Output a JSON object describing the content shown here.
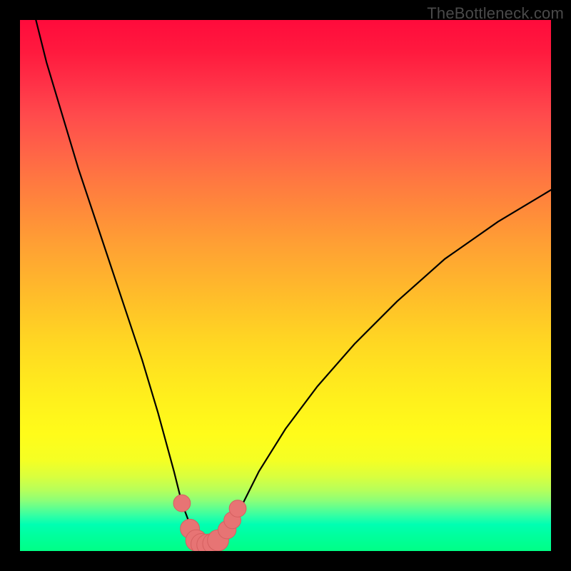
{
  "watermark": "TheBottleneck.com",
  "colors": {
    "frame": "#000000",
    "curve": "#000000",
    "marker_fill": "#e77474",
    "marker_stroke": "#d56060"
  },
  "chart_data": {
    "type": "line",
    "title": "",
    "xlabel": "",
    "ylabel": "",
    "xlim": [
      0,
      100
    ],
    "ylim": [
      0,
      100
    ],
    "grid": false,
    "legend": false,
    "series": [
      {
        "name": "bottleneck-curve",
        "x": [
          3,
          5,
          8,
          11,
          14,
          17,
          20,
          23,
          26,
          29,
          30.5,
          32,
          33.2,
          34.2,
          35,
          36,
          37,
          38.5,
          40,
          42,
          45,
          50,
          56,
          63,
          71,
          80,
          90,
          100
        ],
        "values": [
          100,
          92,
          82,
          72,
          63,
          54,
          45,
          36,
          26,
          15,
          9,
          5,
          2.5,
          1.5,
          1.2,
          1.2,
          1.5,
          2.5,
          5,
          9,
          15,
          23,
          31,
          39,
          47,
          55,
          62,
          68
        ]
      }
    ],
    "markers": [
      {
        "x": 30.5,
        "y": 9.0,
        "r": 1.6
      },
      {
        "x": 32.0,
        "y": 4.2,
        "r": 1.8
      },
      {
        "x": 33.2,
        "y": 2.0,
        "r": 2.0
      },
      {
        "x": 34.2,
        "y": 1.3,
        "r": 2.0
      },
      {
        "x": 35.3,
        "y": 1.2,
        "r": 2.0
      },
      {
        "x": 36.4,
        "y": 1.4,
        "r": 2.0
      },
      {
        "x": 37.3,
        "y": 2.0,
        "r": 2.0
      },
      {
        "x": 39.0,
        "y": 4.0,
        "r": 1.7
      },
      {
        "x": 40.0,
        "y": 5.8,
        "r": 1.6
      },
      {
        "x": 41.0,
        "y": 8.0,
        "r": 1.6
      }
    ]
  }
}
